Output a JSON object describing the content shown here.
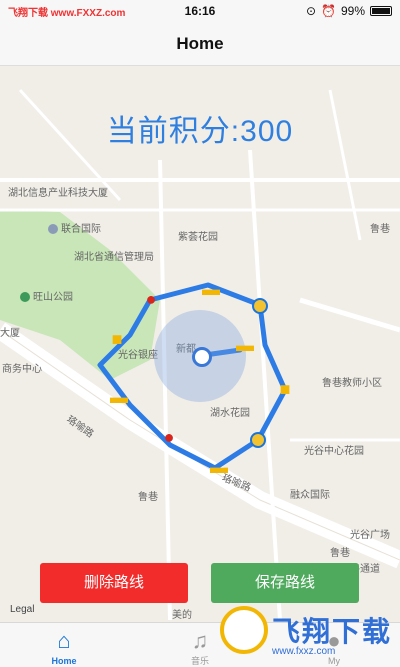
{
  "status_bar": {
    "carrier": "飞翔下载 www.FXXZ.com",
    "time": "16:16",
    "battery": "99%"
  },
  "header": {
    "title": "Home"
  },
  "score": {
    "text": "当前积分:300"
  },
  "map": {
    "labels": [
      "湖北信息产业科技大厦",
      "联合国际",
      "湖北省通信管理局",
      "紫荟花园",
      "鲁巷",
      "旺山公园",
      "大厦",
      "商务中心",
      "光谷银座",
      "新都",
      "鲁巷教师小区",
      "湖水花园",
      "光谷中心花园",
      "融众国际",
      "光谷广场",
      "鲁巷",
      "珞喻路",
      "珞喻路",
      "鲁巷",
      "珞喻路通道",
      "美的"
    ],
    "legal": "Legal"
  },
  "buttons": {
    "delete": "删除路线",
    "save": "保存路线"
  },
  "tabs": [
    {
      "label": "Home",
      "icon": "home-icon",
      "active": true
    },
    {
      "label": "音乐",
      "icon": "music-icon",
      "active": false
    },
    {
      "label": "My",
      "icon": "person-icon",
      "active": false
    }
  ],
  "watermark": {
    "text": "飞翔下载",
    "sub": "www.fxxz.com"
  },
  "colors": {
    "score": "#2f7fe0",
    "route": "#2d7be5",
    "delete_button": "#f22b2b",
    "save_button": "#4faa5e",
    "tab_active": "#1b74d9"
  }
}
